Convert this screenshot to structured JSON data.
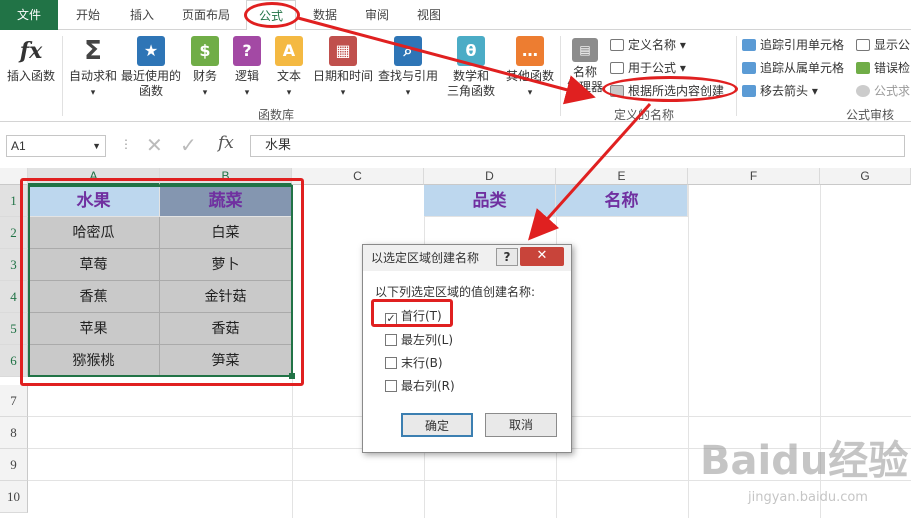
{
  "tabs": [
    "文件",
    "开始",
    "插入",
    "页面布局",
    "公式",
    "数据",
    "审阅",
    "视图"
  ],
  "ribbon": {
    "insert_function": "插入函数",
    "buttons": [
      {
        "label": "自动求和",
        "icon": "sigma-icon"
      },
      {
        "label": "最近使用的\n函数",
        "icon": "star-icon"
      },
      {
        "label": "财务",
        "icon": "finance-icon"
      },
      {
        "label": "逻辑",
        "icon": "logic-icon"
      },
      {
        "label": "文本",
        "icon": "text-icon"
      },
      {
        "label": "日期和时间",
        "icon": "calendar-icon"
      },
      {
        "label": "查找与引用",
        "icon": "lookup-icon"
      },
      {
        "label": "数学和\n三角函数",
        "icon": "theta-icon"
      },
      {
        "label": "其他函数",
        "icon": "more-functions-icon"
      }
    ],
    "group_function_library": "函数库",
    "name_manager": "名称\n管理器",
    "define_name": "定义名称",
    "use_in_formula": "用于公式",
    "create_from_selection": "根据所选内容创建",
    "group_defined_names": "定义的名称",
    "trace_precedents": "追踪引用单元格",
    "trace_dependents": "追踪从属单元格",
    "remove_arrows": "移去箭头",
    "show_formulas": "显示公",
    "error_checking": "错误检",
    "evaluate_formula": "公式求",
    "group_formula_auditing": "公式审核"
  },
  "formula_bar": {
    "name_box": "A1",
    "content": "水果"
  },
  "columns": [
    "A",
    "B",
    "C",
    "D",
    "E",
    "F",
    "G"
  ],
  "rows": [
    "1",
    "2",
    "3",
    "4",
    "5",
    "6",
    "7",
    "8",
    "9",
    "10"
  ],
  "sheet": {
    "A1": "水果",
    "B1": "蔬菜",
    "A": [
      "哈密瓜",
      "草莓",
      "香蕉",
      "苹果",
      "猕猴桃"
    ],
    "B": [
      "白菜",
      "萝卜",
      "金针菇",
      "香菇",
      "笋菜"
    ],
    "D1": "品类",
    "E1": "名称"
  },
  "dialog": {
    "title": "以选定区域创建名称",
    "prompt": "以下列选定区域的值创建名称:",
    "options": [
      {
        "label": "首行(T)",
        "checked": true
      },
      {
        "label": "最左列(L)",
        "checked": false
      },
      {
        "label": "末行(B)",
        "checked": false
      },
      {
        "label": "最右列(R)",
        "checked": false
      }
    ],
    "ok": "确定",
    "cancel": "取消"
  },
  "watermark": {
    "brand": "Baidu经验",
    "url": "jingyan.baidu.com"
  }
}
